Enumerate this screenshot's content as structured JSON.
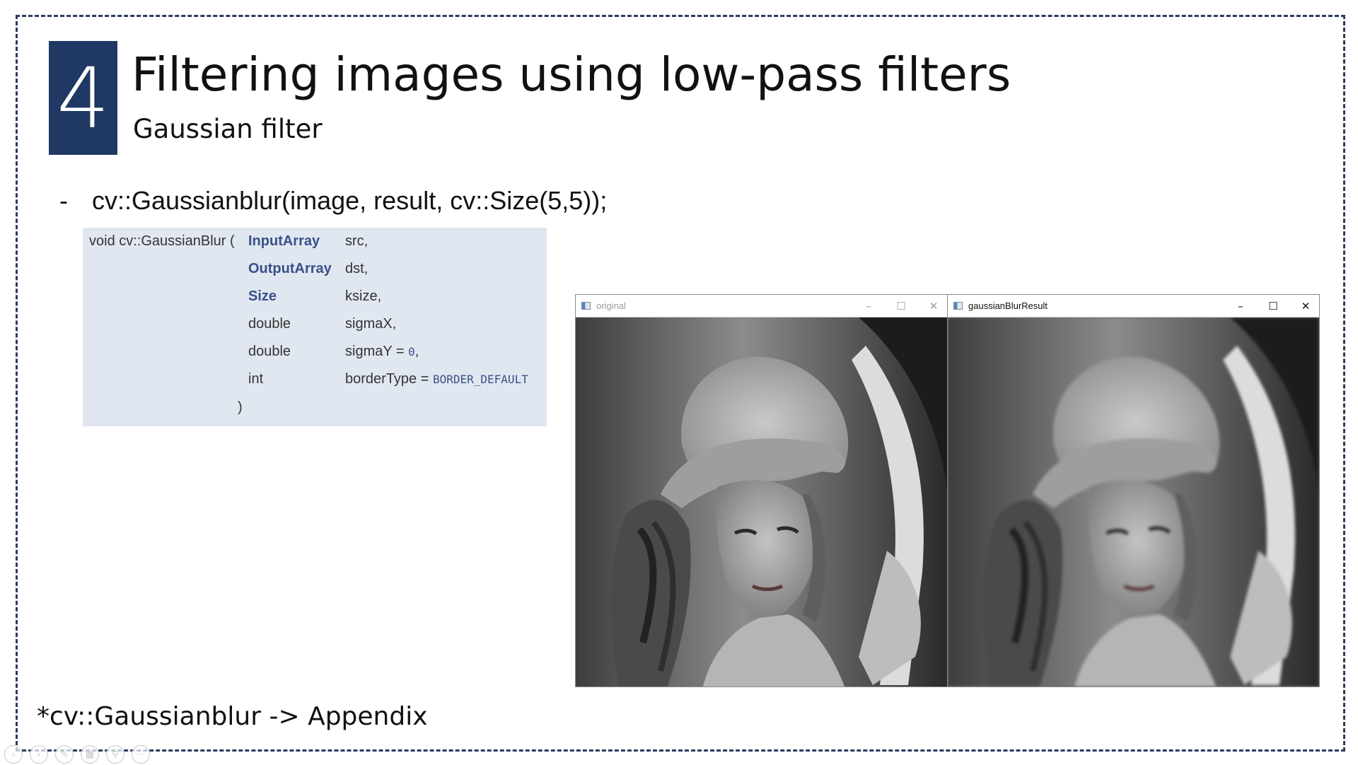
{
  "slide": {
    "number": "4",
    "title": "Filtering images using low-pass filters",
    "subtitle": "Gaussian filter",
    "bullet": {
      "marker": "-",
      "text": "cv::Gaussianblur(image, result, cv::Size(5,5));"
    },
    "footer": "*cv::Gaussianblur -> Appendix"
  },
  "signature": {
    "function": "void cv::GaussianBlur (",
    "params": [
      {
        "type": "InputArray",
        "name": "src,",
        "linked": true
      },
      {
        "type": "OutputArray",
        "name": "dst,",
        "linked": true
      },
      {
        "type": "Size",
        "name": "ksize,",
        "linked": true
      },
      {
        "type": "double",
        "name": "sigmaX,",
        "linked": false
      },
      {
        "type": "double",
        "name": "sigmaY = ",
        "default": "0",
        "suffix": ",",
        "linked": false
      },
      {
        "type": "int",
        "name": "borderType = ",
        "default": "BORDER_DEFAULT",
        "suffix": "",
        "linked": false
      }
    ],
    "close": ")"
  },
  "windows": {
    "original": {
      "title": "original",
      "minimize": "–",
      "maximize": "☐",
      "close": "✕",
      "image": "lena-grayscale-sharp"
    },
    "result": {
      "title": "gaussianBlurResult",
      "minimize": "–",
      "maximize": "☐",
      "close": "✕",
      "image": "lena-grayscale-blurred"
    }
  },
  "colors": {
    "badge": "#1f3864",
    "signature_bg": "#e1e7f1",
    "link": "#3a5187",
    "frame_border": "#2b3b5e"
  },
  "navbar": {
    "icons": [
      "prev-icon",
      "next-icon",
      "pen-icon",
      "slides-icon",
      "zoom-icon",
      "more-icon"
    ]
  }
}
